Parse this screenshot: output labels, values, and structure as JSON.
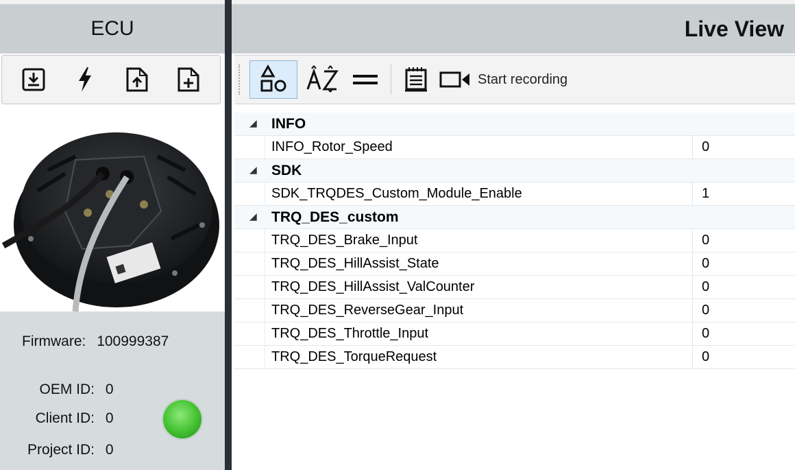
{
  "left_panel": {
    "title": "ECU",
    "toolbar_icons": [
      "download-icon",
      "flash-icon",
      "upload-file-icon",
      "add-file-icon"
    ],
    "firmware_label": "Firmware:",
    "firmware_value": "100999387",
    "oem_label": "OEM ID:",
    "oem_value": "0",
    "client_label": "Client ID:",
    "client_value": "0",
    "project_label": "Project ID:",
    "project_value": "0",
    "status_led_color": "#44c231"
  },
  "right_panel": {
    "title": "Live View",
    "toolbar": {
      "record_label": "Start recording",
      "icons": [
        "group-icon",
        "sort-az-icon",
        "flat-list-icon",
        "log-icon",
        "camera-icon"
      ]
    },
    "groups": [
      {
        "name": "INFO",
        "params": [
          {
            "name": "INFO_Rotor_Speed",
            "value": "0"
          }
        ]
      },
      {
        "name": "SDK",
        "params": [
          {
            "name": "SDK_TRQDES_Custom_Module_Enable",
            "value": "1"
          }
        ]
      },
      {
        "name": "TRQ_DES_custom",
        "params": [
          {
            "name": "TRQ_DES_Brake_Input",
            "value": "0"
          },
          {
            "name": "TRQ_DES_HillAssist_State",
            "value": "0"
          },
          {
            "name": "TRQ_DES_HillAssist_ValCounter",
            "value": "0"
          },
          {
            "name": "TRQ_DES_ReverseGear_Input",
            "value": "0"
          },
          {
            "name": "TRQ_DES_Throttle_Input",
            "value": "0"
          },
          {
            "name": "TRQ_DES_TorqueRequest",
            "value": "0"
          }
        ]
      }
    ],
    "expander_glyph": "◢"
  }
}
